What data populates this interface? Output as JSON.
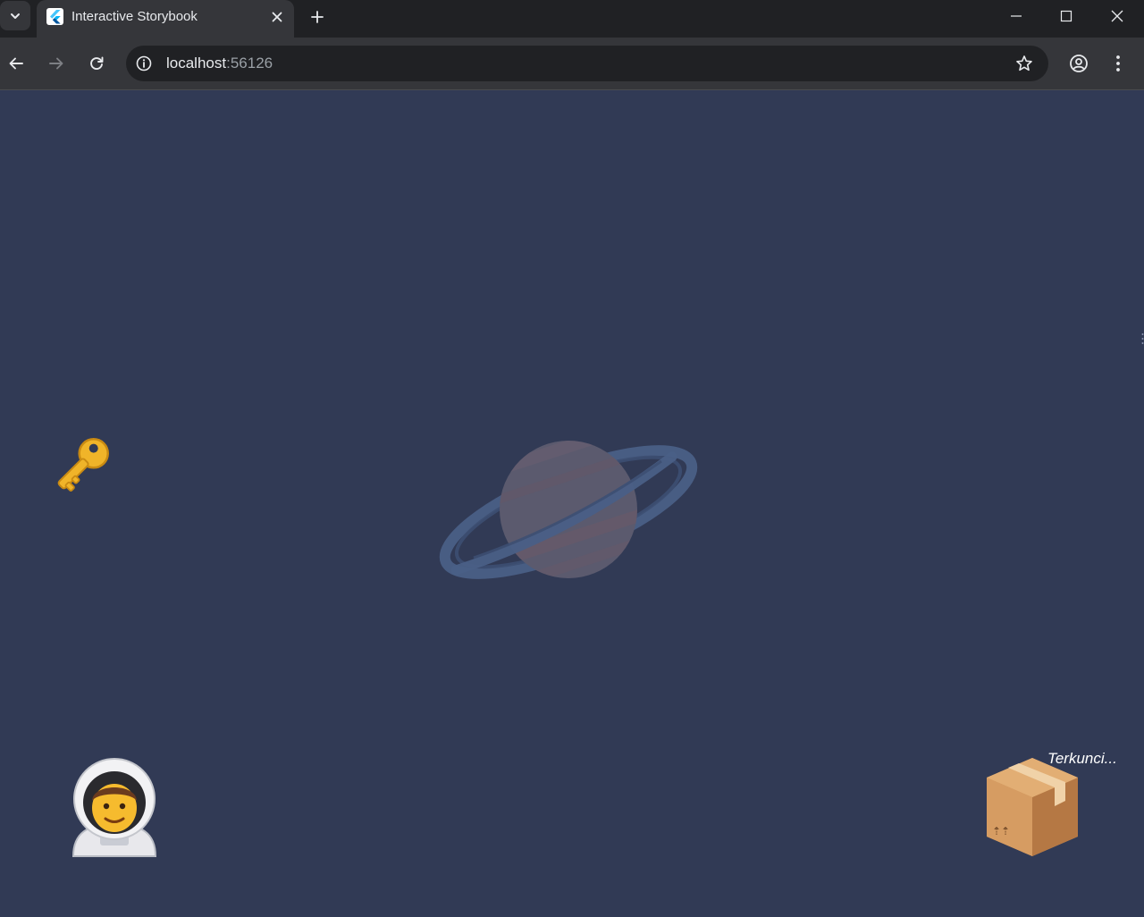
{
  "browser": {
    "tab": {
      "title": "Interactive Storybook",
      "favicon": "flutter-logo-icon"
    },
    "address_bar": {
      "host": "localhost",
      "port": ":56126"
    },
    "icons": {
      "tab_search": "chevron-down-icon",
      "tab_close": "close-icon",
      "new_tab": "plus-icon",
      "minimize": "minimize-icon",
      "maximize": "maximize-icon",
      "close_window": "close-icon",
      "back": "arrow-left-icon",
      "forward": "arrow-right-icon",
      "reload": "reload-icon",
      "site_info": "info-icon",
      "bookmark": "star-icon",
      "profile": "profile-icon",
      "menu": "kebab-menu-icon"
    },
    "colors": {
      "tab_strip": "#202124",
      "toolbar": "#35363a",
      "omnibox": "#202124"
    }
  },
  "scene": {
    "background_color": "#313a55",
    "sprites": {
      "key": "key-icon",
      "planet": "ringed-planet-icon",
      "astronaut": "astronaut-icon",
      "box": "package-box-icon"
    },
    "box_status": "Terkunci..."
  }
}
